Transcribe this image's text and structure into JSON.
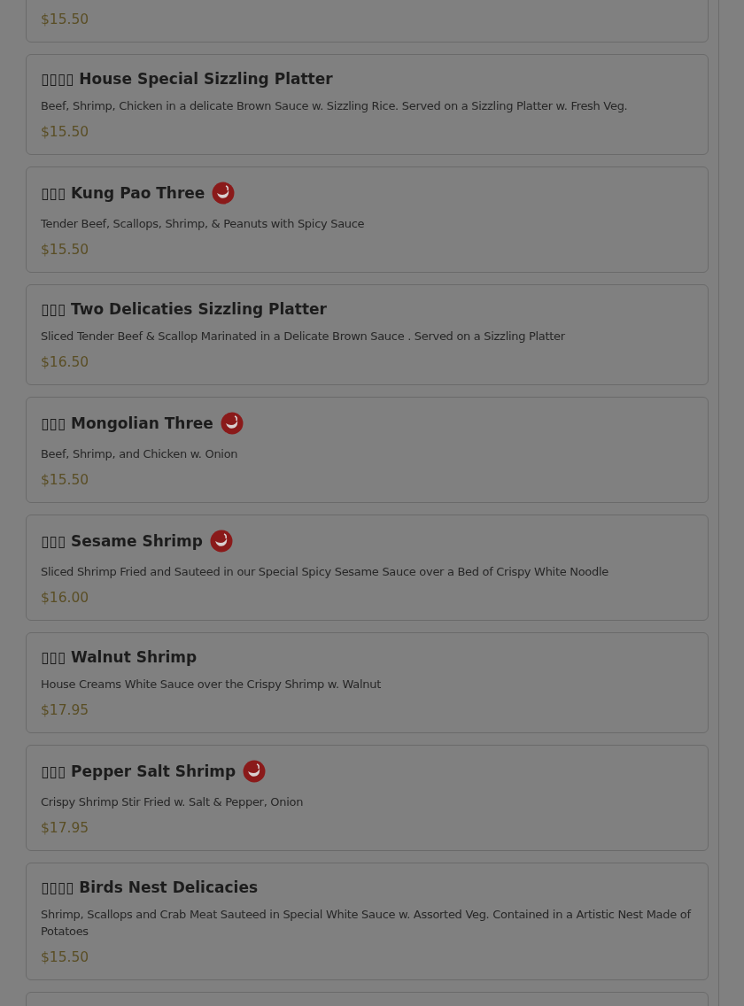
{
  "items": [
    {
      "price": "$15.50"
    },
    {
      "name": "▯▯▯▯ House Special Sizzling Platter",
      "spicy": false,
      "description": "Beef, Shrimp, Chicken in a delicate Brown Sauce w. Sizzling Rice. Served on a Sizzling Platter w. Fresh Veg.",
      "price": "$15.50"
    },
    {
      "name": "▯▯▯ Kung Pao Three",
      "spicy": true,
      "description": "Tender Beef, Scallops, Shrimp, & Peanuts with Spicy Sauce",
      "price": "$15.50"
    },
    {
      "name": "▯▯▯ Two Delicaties Sizzling Platter",
      "spicy": false,
      "description": "Sliced Tender Beef & Scallop Marinated in a Delicate Brown Sauce . Served on a Sizzling Platter",
      "price": "$16.50"
    },
    {
      "name": "▯▯▯ Mongolian Three",
      "spicy": true,
      "description": "Beef, Shrimp, and Chicken w. Onion",
      "price": "$15.50"
    },
    {
      "name": "▯▯▯ Sesame Shrimp",
      "spicy": true,
      "description": "Sliced Shrimp Fried and Sauteed in our Special Spicy Sesame Sauce over a Bed of Crispy White Noodle",
      "price": "$16.00"
    },
    {
      "name": "▯▯▯ Walnut Shrimp",
      "spicy": false,
      "description": "House Creams White Sauce over the Crispy Shrimp w. Walnut",
      "price": "$17.95"
    },
    {
      "name": "▯▯▯ Pepper Salt Shrimp",
      "spicy": true,
      "description": "Crispy Shrimp Stir Fried w. Salt & Pepper, Onion",
      "price": "$17.95"
    },
    {
      "name": "▯▯▯▯ Birds Nest Delicacies",
      "spicy": false,
      "description": "Shrimp, Scallops and Crab Meat Sauteed in Special White Sauce w. Assorted Veg. Contained in a Artistic Nest Made of Potatoes",
      "price": "$15.50"
    }
  ]
}
